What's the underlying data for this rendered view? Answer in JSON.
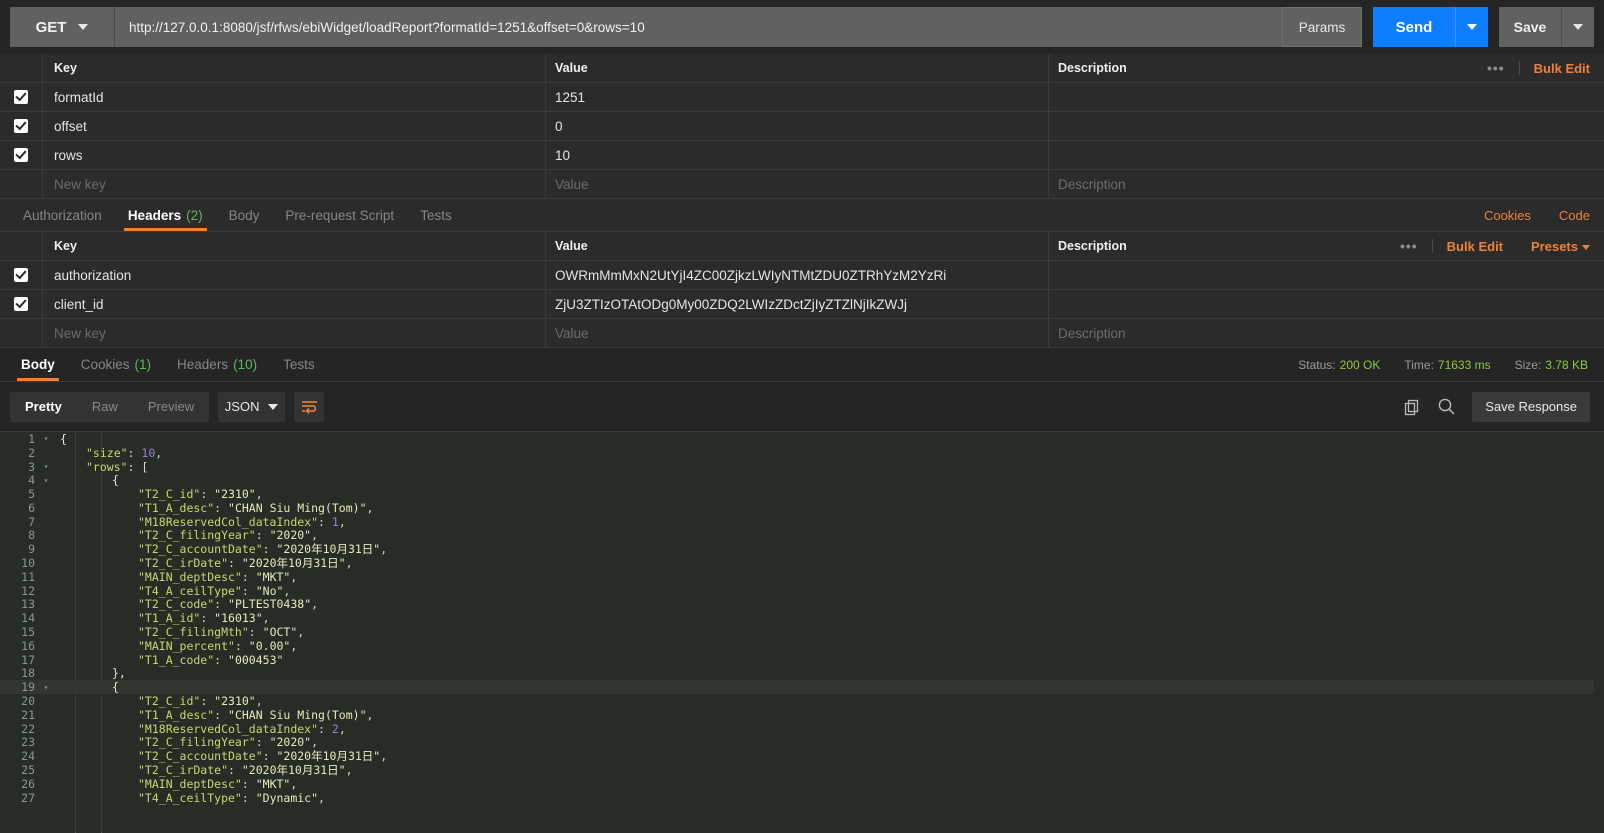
{
  "urlbar": {
    "method": "GET",
    "url": "http://127.0.0.1:8080/jsf/rfws/ebiWidget/loadReport?formatId=1251&offset=0&rows=10",
    "params_label": "Params",
    "send_label": "Send",
    "save_label": "Save"
  },
  "params_table": {
    "headers": {
      "key": "Key",
      "value": "Value",
      "description": "Description"
    },
    "dots": "•••",
    "bulk_edit": "Bulk Edit",
    "rows": [
      {
        "checked": true,
        "key": "formatId",
        "value": "1251",
        "description": ""
      },
      {
        "checked": true,
        "key": "offset",
        "value": "0",
        "description": ""
      },
      {
        "checked": true,
        "key": "rows",
        "value": "10",
        "description": ""
      }
    ],
    "new_row": {
      "key_placeholder": "New key",
      "value_placeholder": "Value",
      "desc_placeholder": "Description"
    }
  },
  "request_tabs": {
    "items": [
      {
        "label": "Authorization",
        "count": "",
        "active": false
      },
      {
        "label": "Headers",
        "count": "(2)",
        "active": true
      },
      {
        "label": "Body",
        "count": "",
        "active": false
      },
      {
        "label": "Pre-request Script",
        "count": "",
        "active": false
      },
      {
        "label": "Tests",
        "count": "",
        "active": false
      }
    ],
    "cookies_link": "Cookies",
    "code_link": "Code"
  },
  "headers_table": {
    "headers": {
      "key": "Key",
      "value": "Value",
      "description": "Description"
    },
    "dots": "•••",
    "bulk_edit": "Bulk Edit",
    "presets": "Presets",
    "rows": [
      {
        "checked": true,
        "key": "authorization",
        "value": "OWRmMmMxN2UtYjI4ZC00ZjkzLWIyNTMtZDU0ZTRhYzM2YzRi",
        "description": ""
      },
      {
        "checked": true,
        "key": "client_id",
        "value": "ZjU3ZTIzOTAtODg0My00ZDQ2LWIzZDctZjIyZTZlNjIkZWJj",
        "description": ""
      }
    ],
    "new_row": {
      "key_placeholder": "New key",
      "value_placeholder": "Value",
      "desc_placeholder": "Description"
    }
  },
  "response_tabs": {
    "items": [
      {
        "label": "Body",
        "count": "",
        "active": true
      },
      {
        "label": "Cookies",
        "count": "(1)",
        "active": false
      },
      {
        "label": "Headers",
        "count": "(10)",
        "active": false
      },
      {
        "label": "Tests",
        "count": "",
        "active": false
      }
    ],
    "status_label": "Status:",
    "status_value": "200 OK",
    "time_label": "Time:",
    "time_value": "71633 ms",
    "size_label": "Size:",
    "size_value": "3.78 KB"
  },
  "response_toolbar": {
    "view_modes": [
      {
        "label": "Pretty",
        "active": true
      },
      {
        "label": "Raw",
        "active": false
      },
      {
        "label": "Preview",
        "active": false
      }
    ],
    "format": "JSON",
    "wrap_icon": "word-wrap-icon",
    "copy_icon": "copy-icon",
    "search_icon": "search-icon",
    "save_response": "Save Response"
  },
  "colors": {
    "accent": "#ef8136",
    "send": "#0d7eff",
    "success": "#8ec640",
    "count": "#5cb85c"
  },
  "response_body": {
    "lines": [
      {
        "no": "1",
        "fold": true,
        "indent": 0,
        "tokens": [
          {
            "t": "{",
            "c": "b"
          }
        ]
      },
      {
        "no": "2",
        "fold": false,
        "indent": 1,
        "tokens": [
          {
            "t": "\"size\"",
            "c": "k"
          },
          {
            "t": ": ",
            "c": "p"
          },
          {
            "t": "10",
            "c": "n"
          },
          {
            "t": ",",
            "c": "p"
          }
        ]
      },
      {
        "no": "3",
        "fold": true,
        "indent": 1,
        "tokens": [
          {
            "t": "\"rows\"",
            "c": "k"
          },
          {
            "t": ": [",
            "c": "p"
          }
        ]
      },
      {
        "no": "4",
        "fold": true,
        "indent": 2,
        "tokens": [
          {
            "t": "{",
            "c": "b"
          }
        ]
      },
      {
        "no": "5",
        "fold": false,
        "indent": 3,
        "tokens": [
          {
            "t": "\"T2_C_id\"",
            "c": "k"
          },
          {
            "t": ": ",
            "c": "p"
          },
          {
            "t": "\"2310\"",
            "c": "s"
          },
          {
            "t": ",",
            "c": "p"
          }
        ]
      },
      {
        "no": "6",
        "fold": false,
        "indent": 3,
        "tokens": [
          {
            "t": "\"T1_A_desc\"",
            "c": "k"
          },
          {
            "t": ": ",
            "c": "p"
          },
          {
            "t": "\"CHAN Siu Ming(Tom)\"",
            "c": "s"
          },
          {
            "t": ",",
            "c": "p"
          }
        ]
      },
      {
        "no": "7",
        "fold": false,
        "indent": 3,
        "tokens": [
          {
            "t": "\"M18ReservedCol_dataIndex\"",
            "c": "k"
          },
          {
            "t": ": ",
            "c": "p"
          },
          {
            "t": "1",
            "c": "n"
          },
          {
            "t": ",",
            "c": "p"
          }
        ]
      },
      {
        "no": "8",
        "fold": false,
        "indent": 3,
        "tokens": [
          {
            "t": "\"T2_C_filingYear\"",
            "c": "k"
          },
          {
            "t": ": ",
            "c": "p"
          },
          {
            "t": "\"2020\"",
            "c": "s"
          },
          {
            "t": ",",
            "c": "p"
          }
        ]
      },
      {
        "no": "9",
        "fold": false,
        "indent": 3,
        "tokens": [
          {
            "t": "\"T2_C_accountDate\"",
            "c": "k"
          },
          {
            "t": ": ",
            "c": "p"
          },
          {
            "t": "\"2020年10月31日\"",
            "c": "s"
          },
          {
            "t": ",",
            "c": "p"
          }
        ]
      },
      {
        "no": "10",
        "fold": false,
        "indent": 3,
        "tokens": [
          {
            "t": "\"T2_C_irDate\"",
            "c": "k"
          },
          {
            "t": ": ",
            "c": "p"
          },
          {
            "t": "\"2020年10月31日\"",
            "c": "s"
          },
          {
            "t": ",",
            "c": "p"
          }
        ]
      },
      {
        "no": "11",
        "fold": false,
        "indent": 3,
        "tokens": [
          {
            "t": "\"MAIN_deptDesc\"",
            "c": "k"
          },
          {
            "t": ": ",
            "c": "p"
          },
          {
            "t": "\"MKT\"",
            "c": "s"
          },
          {
            "t": ",",
            "c": "p"
          }
        ]
      },
      {
        "no": "12",
        "fold": false,
        "indent": 3,
        "tokens": [
          {
            "t": "\"T4_A_ceilType\"",
            "c": "k"
          },
          {
            "t": ": ",
            "c": "p"
          },
          {
            "t": "\"No\"",
            "c": "s"
          },
          {
            "t": ",",
            "c": "p"
          }
        ]
      },
      {
        "no": "13",
        "fold": false,
        "indent": 3,
        "tokens": [
          {
            "t": "\"T2_C_code\"",
            "c": "k"
          },
          {
            "t": ": ",
            "c": "p"
          },
          {
            "t": "\"PLTEST0438\"",
            "c": "s"
          },
          {
            "t": ",",
            "c": "p"
          }
        ]
      },
      {
        "no": "14",
        "fold": false,
        "indent": 3,
        "tokens": [
          {
            "t": "\"T1_A_id\"",
            "c": "k"
          },
          {
            "t": ": ",
            "c": "p"
          },
          {
            "t": "\"16013\"",
            "c": "s"
          },
          {
            "t": ",",
            "c": "p"
          }
        ]
      },
      {
        "no": "15",
        "fold": false,
        "indent": 3,
        "tokens": [
          {
            "t": "\"T2_C_filingMth\"",
            "c": "k"
          },
          {
            "t": ": ",
            "c": "p"
          },
          {
            "t": "\"OCT\"",
            "c": "s"
          },
          {
            "t": ",",
            "c": "p"
          }
        ]
      },
      {
        "no": "16",
        "fold": false,
        "indent": 3,
        "tokens": [
          {
            "t": "\"MAIN_percent\"",
            "c": "k"
          },
          {
            "t": ": ",
            "c": "p"
          },
          {
            "t": "\"0.00\"",
            "c": "s"
          },
          {
            "t": ",",
            "c": "p"
          }
        ]
      },
      {
        "no": "17",
        "fold": false,
        "indent": 3,
        "tokens": [
          {
            "t": "\"T1_A_code\"",
            "c": "k"
          },
          {
            "t": ": ",
            "c": "p"
          },
          {
            "t": "\"000453\"",
            "c": "s"
          }
        ]
      },
      {
        "no": "18",
        "fold": false,
        "indent": 2,
        "tokens": [
          {
            "t": "},",
            "c": "b"
          }
        ]
      },
      {
        "no": "19",
        "fold": true,
        "indent": 2,
        "highlight": true,
        "tokens": [
          {
            "t": "{",
            "c": "b"
          }
        ]
      },
      {
        "no": "20",
        "fold": false,
        "indent": 3,
        "tokens": [
          {
            "t": "\"T2_C_id\"",
            "c": "k"
          },
          {
            "t": ": ",
            "c": "p"
          },
          {
            "t": "\"2310\"",
            "c": "s"
          },
          {
            "t": ",",
            "c": "p"
          }
        ]
      },
      {
        "no": "21",
        "fold": false,
        "indent": 3,
        "tokens": [
          {
            "t": "\"T1_A_desc\"",
            "c": "k"
          },
          {
            "t": ": ",
            "c": "p"
          },
          {
            "t": "\"CHAN Siu Ming(Tom)\"",
            "c": "s"
          },
          {
            "t": ",",
            "c": "p"
          }
        ]
      },
      {
        "no": "22",
        "fold": false,
        "indent": 3,
        "tokens": [
          {
            "t": "\"M18ReservedCol_dataIndex\"",
            "c": "k"
          },
          {
            "t": ": ",
            "c": "p"
          },
          {
            "t": "2",
            "c": "n"
          },
          {
            "t": ",",
            "c": "p"
          }
        ]
      },
      {
        "no": "23",
        "fold": false,
        "indent": 3,
        "tokens": [
          {
            "t": "\"T2_C_filingYear\"",
            "c": "k"
          },
          {
            "t": ": ",
            "c": "p"
          },
          {
            "t": "\"2020\"",
            "c": "s"
          },
          {
            "t": ",",
            "c": "p"
          }
        ]
      },
      {
        "no": "24",
        "fold": false,
        "indent": 3,
        "tokens": [
          {
            "t": "\"T2_C_accountDate\"",
            "c": "k"
          },
          {
            "t": ": ",
            "c": "p"
          },
          {
            "t": "\"2020年10月31日\"",
            "c": "s"
          },
          {
            "t": ",",
            "c": "p"
          }
        ]
      },
      {
        "no": "25",
        "fold": false,
        "indent": 3,
        "tokens": [
          {
            "t": "\"T2_C_irDate\"",
            "c": "k"
          },
          {
            "t": ": ",
            "c": "p"
          },
          {
            "t": "\"2020年10月31日\"",
            "c": "s"
          },
          {
            "t": ",",
            "c": "p"
          }
        ]
      },
      {
        "no": "26",
        "fold": false,
        "indent": 3,
        "tokens": [
          {
            "t": "\"MAIN_deptDesc\"",
            "c": "k"
          },
          {
            "t": ": ",
            "c": "p"
          },
          {
            "t": "\"MKT\"",
            "c": "s"
          },
          {
            "t": ",",
            "c": "p"
          }
        ]
      },
      {
        "no": "27",
        "fold": false,
        "indent": 3,
        "tokens": [
          {
            "t": "\"T4_A_ceilType\"",
            "c": "k"
          },
          {
            "t": ": ",
            "c": "p"
          },
          {
            "t": "\"Dynamic\"",
            "c": "s"
          },
          {
            "t": ",",
            "c": "p"
          }
        ]
      }
    ]
  }
}
